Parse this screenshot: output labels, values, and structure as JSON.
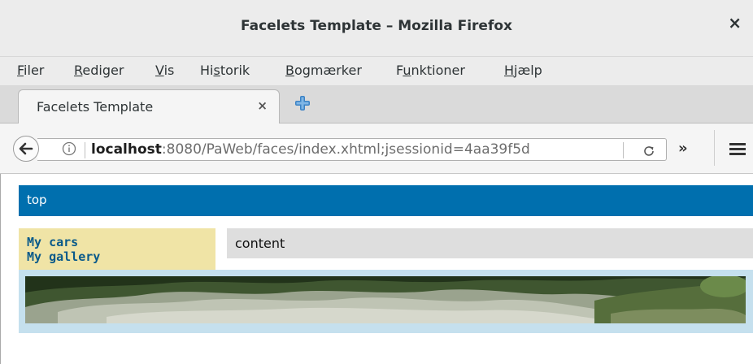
{
  "window": {
    "title": "Facelets Template – Mozilla Firefox",
    "close_glyph": "×"
  },
  "menu": [
    {
      "pre": "",
      "ul": "F",
      "post": "iler"
    },
    {
      "pre": "",
      "ul": "R",
      "post": "ediger"
    },
    {
      "pre": "",
      "ul": "V",
      "post": "is"
    },
    {
      "pre": "Hi",
      "ul": "s",
      "post": "torik"
    },
    {
      "pre": "",
      "ul": "B",
      "post": "ogmærker"
    },
    {
      "pre": "F",
      "ul": "u",
      "post": "nktioner"
    },
    {
      "pre": "",
      "ul": "H",
      "post": "jælp"
    }
  ],
  "tab": {
    "title": "Facelets Template",
    "close_glyph": "×"
  },
  "icons": {
    "back": "back-arrow-icon",
    "info": "info-icon",
    "reload": "reload-icon",
    "new_tab": "plus-icon",
    "overflow": "double-chevron-icon",
    "menu": "hamburger-menu-icon"
  },
  "url": {
    "host": "localhost",
    "rest": ":8080/PaWeb/faces/index.xhtml;jsessionid=4aa39f5d"
  },
  "overflow_glyph": "»",
  "page": {
    "top": "top",
    "nav": [
      "My cars",
      "My gallery"
    ],
    "content": "content"
  },
  "colors": {
    "top_bar": "#006fae",
    "left_nav": "#f0e4a6",
    "content_box": "#dedede",
    "banner_frame": "#c5e0ee",
    "link": "#0a5a8a",
    "new_tab_plus": "#3b82c4"
  }
}
